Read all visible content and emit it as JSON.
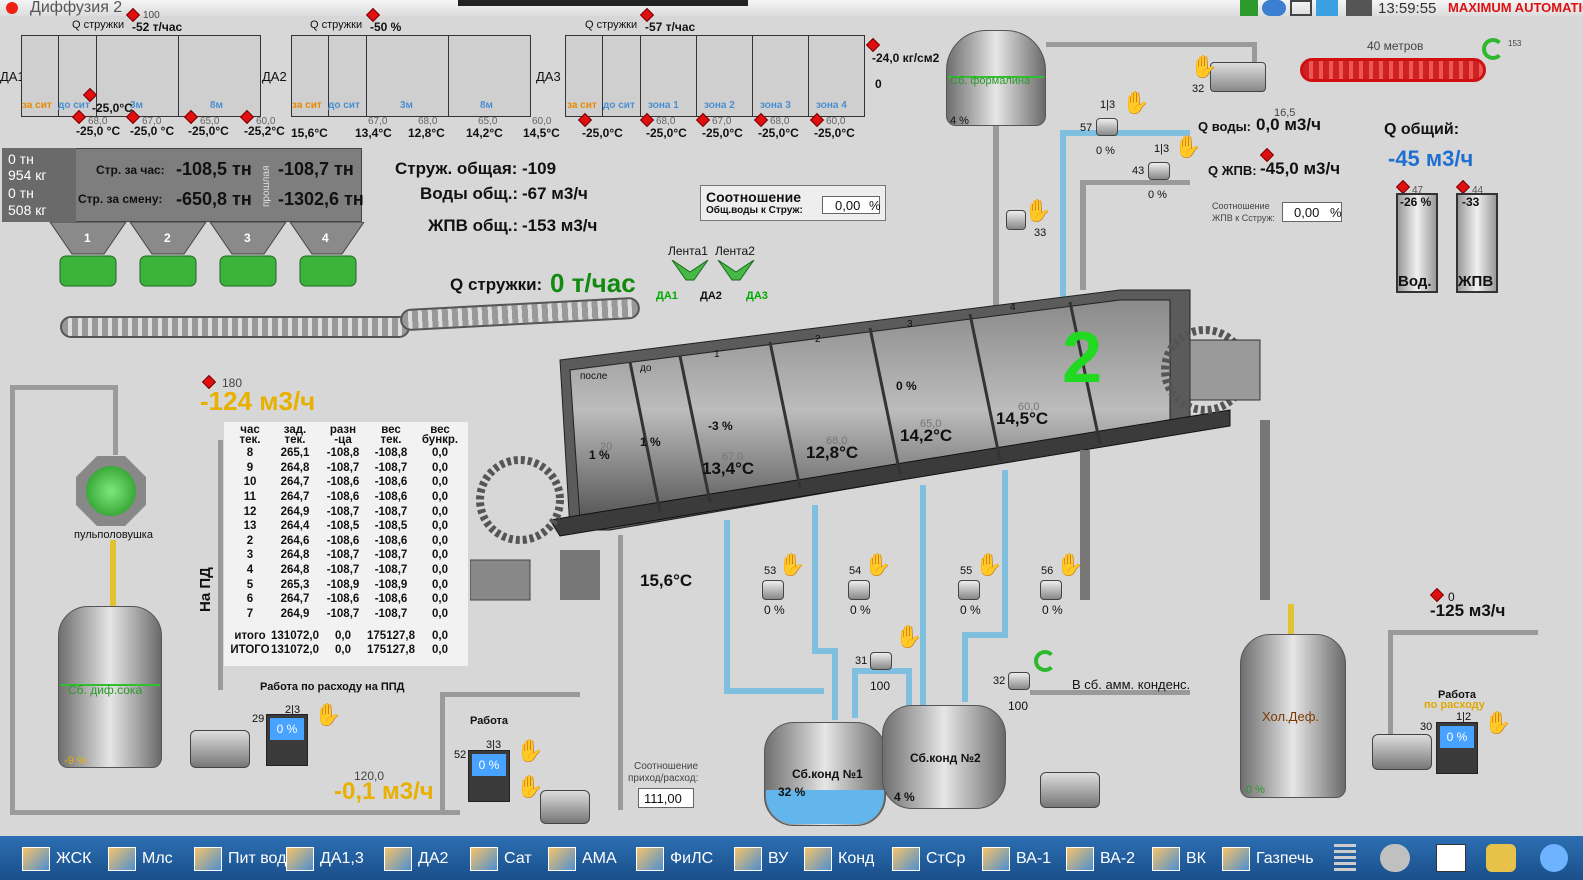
{
  "window": {
    "title": "Диффузия 2",
    "clock": "13:59:55",
    "logo": "MAXIMUM AUTOMATION"
  },
  "diffusers": {
    "da1": {
      "label": "ДА1",
      "q_label": "Q стружки",
      "q_value": "-52 т/час",
      "sensor": "100",
      "temp_top": "-25,0°C",
      "sections": [
        "за сит",
        "до сит",
        "3м",
        "8м"
      ],
      "temps": [
        "-25,0 °C",
        "-25,0 °C",
        "-25,0°C",
        "-25,2°C"
      ],
      "setpoints": [
        "68,0",
        "67,0",
        "65,0",
        "60,0"
      ]
    },
    "da2": {
      "label": "ДА2",
      "q_label": "Q стружки",
      "q_value": "-50 %",
      "sections": [
        "за сит",
        "до сит",
        "3м",
        "8м"
      ],
      "temps": [
        "15,6°C",
        "13,4°C",
        "12,8°C",
        "14,2°C",
        "14,5°C"
      ],
      "setpoints": [
        "67,0",
        "68,0",
        "65,0",
        "60,0"
      ]
    },
    "da3": {
      "label": "ДА3",
      "q_label": "Q стружки",
      "q_value": "-57 т/час",
      "sections": [
        "за сит",
        "до сит",
        "зона 1",
        "зона 2",
        "зона 3",
        "зона 4"
      ],
      "temps": [
        "-25,0°C",
        "-25,0°C",
        "-25,0°C",
        "-25,0°C",
        "-25,0°C"
      ],
      "setpoints": [
        "68,0",
        "67,0",
        "68,0",
        "67,0",
        "60,0"
      ],
      "pressure": "-24,0 кг/см2",
      "zero": "0"
    }
  },
  "scale": {
    "rows": [
      [
        "0 тн",
        "954 кг"
      ],
      [
        "0 тн",
        "508 кг"
      ]
    ],
    "hour_label": "Стр. за час:",
    "hour_value": "-108,5 тн",
    "hour_prev": "-108,7 тн",
    "shift_label": "Стр. за смену:",
    "shift_value": "-650,8 тн",
    "shift_prev": "-1302,6 тн",
    "prev_label": "прошлая",
    "hoppers": [
      "1",
      "2",
      "3",
      "4"
    ]
  },
  "totals": {
    "chips_label": "Струж. общая:",
    "chips_value": "-109",
    "water_label": "Воды общ.:",
    "water_value": "-67 м3/ч",
    "zhpv_label": "ЖПВ общ.:",
    "zhpv_value": "-153 м3/ч"
  },
  "ratio": {
    "title": "Соотношение",
    "sub": "Общ.воды к Струж:",
    "value": "0,00",
    "unit": "%"
  },
  "ratio2": {
    "title": "Соотношение",
    "sub": "ЖПВ к Cструж:",
    "value": "0,00",
    "unit": "%"
  },
  "conveyor": {
    "q_label": "Q стружки:",
    "q_value": "0 т/час",
    "belt1": "Лента1",
    "belt2": "Лента2",
    "targets": [
      "ДА1",
      "ДА2",
      "ДА3"
    ]
  },
  "tank_form": {
    "label": "Сб. формалина",
    "pct": "4 %"
  },
  "belt40": {
    "label": "40 метров",
    "motor": "32",
    "indicator": "153"
  },
  "valves": {
    "v57": {
      "id": "57",
      "ratio": "1|3",
      "pct": "0 %"
    },
    "v43": {
      "id": "43",
      "ratio": "1|3",
      "pct": "0 %"
    },
    "v33": {
      "id": "33"
    },
    "v31": {
      "id": "31",
      "pct": "100"
    },
    "v32": {
      "id": "32",
      "pct": "100"
    },
    "v53": {
      "id": "53",
      "pct": "0 %"
    },
    "v54": {
      "id": "54",
      "pct": "0 %"
    },
    "v55": {
      "id": "55",
      "pct": "0 %"
    },
    "v56": {
      "id": "56",
      "pct": "0 %"
    }
  },
  "flows": {
    "water_label": "Q воды:",
    "water_value": "0,0 м3/ч",
    "water_sp": "16,5",
    "zhpv_label": "Q ЖПВ:",
    "zhpv_value": "-45,0 м3/ч",
    "total_label": "Q общий:",
    "total_value": "-45 м3/ч"
  },
  "bars": {
    "water": {
      "pct": "-26 %",
      "label": "Вод.",
      "sp": "47"
    },
    "zhpv": {
      "pct": "-33",
      "label": "ЖПВ",
      "sp": "44"
    }
  },
  "drum": {
    "number": "2",
    "zones": [
      "после",
      "до",
      "1",
      "2",
      "3",
      "4"
    ],
    "pcts": [
      "1 %",
      "1 %",
      "-3 %",
      "0 %"
    ],
    "temps": [
      "13,4°C",
      "12,8°C",
      "14,2°C",
      "14,5°C"
    ],
    "sps": [
      "20",
      "67,0",
      "68,0",
      "65,0",
      "60,0"
    ],
    "outlet_temp": "15,6°C"
  },
  "pulp": {
    "flow_sp": "180",
    "flow": "-124 м3/ч",
    "trap": "пульполовушка",
    "na_pd": "На ПД"
  },
  "table": {
    "headers": [
      [
        "час",
        "тек."
      ],
      [
        "зад.",
        "тек."
      ],
      [
        "разн",
        "-ца"
      ],
      [
        "вес",
        "тек."
      ],
      [
        "вес",
        "бункр."
      ]
    ],
    "rows": [
      [
        "8",
        "265,1",
        "-108,8",
        "-108,8",
        "0,0"
      ],
      [
        "9",
        "264,8",
        "-108,7",
        "-108,7",
        "0,0"
      ],
      [
        "10",
        "264,7",
        "-108,6",
        "-108,6",
        "0,0"
      ],
      [
        "11",
        "264,7",
        "-108,6",
        "-108,6",
        "0,0"
      ],
      [
        "12",
        "264,9",
        "-108,7",
        "-108,7",
        "0,0"
      ],
      [
        "13",
        "264,4",
        "-108,5",
        "-108,5",
        "0,0"
      ],
      [
        "2",
        "264,6",
        "-108,6",
        "-108,6",
        "0,0"
      ],
      [
        "3",
        "264,8",
        "-108,7",
        "-108,7",
        "0,0"
      ],
      [
        "4",
        "264,8",
        "-108,7",
        "-108,7",
        "0,0"
      ],
      [
        "5",
        "265,3",
        "-108,9",
        "-108,9",
        "0,0"
      ],
      [
        "6",
        "264,7",
        "-108,6",
        "-108,6",
        "0,0"
      ],
      [
        "7",
        "264,9",
        "-108,7",
        "-108,7",
        "0,0"
      ]
    ],
    "totals": [
      [
        "итого",
        "131072,0",
        "0,0",
        "175127,8",
        "0,0"
      ],
      [
        "ИТОГО",
        "131072,0",
        "0,0",
        "175127,8",
        "0,0"
      ]
    ]
  },
  "juice_tank": {
    "label": "Сб. диф.сока",
    "pct": "-9 %",
    "pump_label": "Работа по расходу на ППД",
    "pump_ratio": "2|3",
    "pump_id": "29",
    "pump_pct": "0 %",
    "flow_sp": "120,0",
    "flow": "-0,1 м3/ч"
  },
  "work_pump": {
    "label": "Работа",
    "ratio": "3|3",
    "id": "52",
    "pct": "0 %"
  },
  "ratio3": {
    "label1": "Соотношение",
    "label2": "приход/расход:",
    "value": "111,00"
  },
  "cond": {
    "t1": "Сб.конд №1",
    "p1": "32 %",
    "t2": "Сб.конд №2",
    "p2": "4 %",
    "to_amm": "В сб. амм. конденс."
  },
  "cold": {
    "label": "Хол.Деф.",
    "pct": "0 %",
    "flow_sp": "0",
    "flow": "-125 м3/ч",
    "pump_label": "Работа",
    "pump_label2": "по расходу",
    "ratio": "1|2",
    "id": "30",
    "pct2": "0 %"
  },
  "taskbar": [
    "ЖСК",
    "Млс",
    "Пит вода",
    "ДА1,3",
    "ДА2",
    "Сат",
    "АМА",
    "ФиЛС",
    "ВУ",
    "Конд",
    "СтСр",
    "ВА-1",
    "ВА-2",
    "ВК",
    "Газпечь"
  ]
}
